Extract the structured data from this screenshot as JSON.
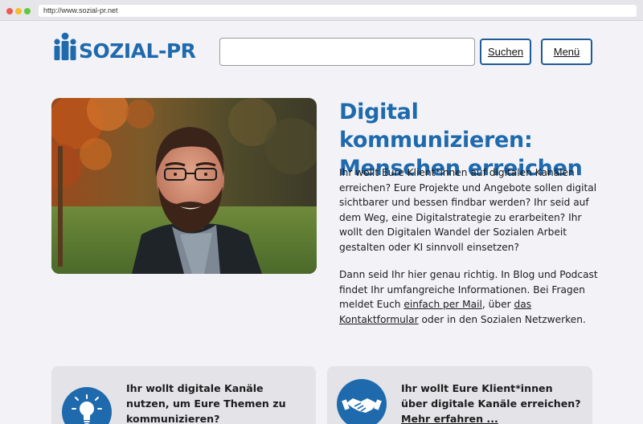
{
  "browser": {
    "url": "http://www.sozial-pr.net"
  },
  "header": {
    "logo_text": "SOZIAL-PR",
    "search_value": "",
    "search_button": "Suchen",
    "menu_button": "Menü"
  },
  "hero": {
    "title_line1": "Digital kommunizieren:",
    "title_line2": "Menschen erreichen",
    "paragraph1": "Ihr wollt Eure Klient*innen auf digitalen Kanälen erreichen? Eure Projekte und Angebote sollen digital sichtbarer und bessen findbar werden? Ihr seid auf dem Weg, eine Digitalstrategie zu erarbeiten? Ihr wollt den Digitalen Wandel der Sozialen Arbeit gestalten oder KI sinnvoll einsetzen?",
    "paragraph2_part1": "Dann seid Ihr hier genau richtig. In Blog und Podcast findet Ihr umfangreiche Informationen. Bei Fragen meldet Euch ",
    "paragraph2_link1": "einfach per Mail",
    "paragraph2_part2": ", über ",
    "paragraph2_link2": "das Kontaktformular",
    "paragraph2_part3": " oder in den Sozialen Netzwerken."
  },
  "cards": [
    {
      "icon": "lightbulb-icon",
      "text": "Ihr wollt digitale Kanäle nutzen, um Eure Themen zu kommunizieren?"
    },
    {
      "icon": "handshake-icon",
      "text": "Ihr wollt Eure Klient*innen über digitale Kanäle erreichen?",
      "link": "Mehr erfahren ..."
    }
  ],
  "colors": {
    "brand_blue": "#1e6aad",
    "button_border": "#1e5c98",
    "page_background": "#f3f2f7",
    "card_background": "#e4e3e8"
  }
}
